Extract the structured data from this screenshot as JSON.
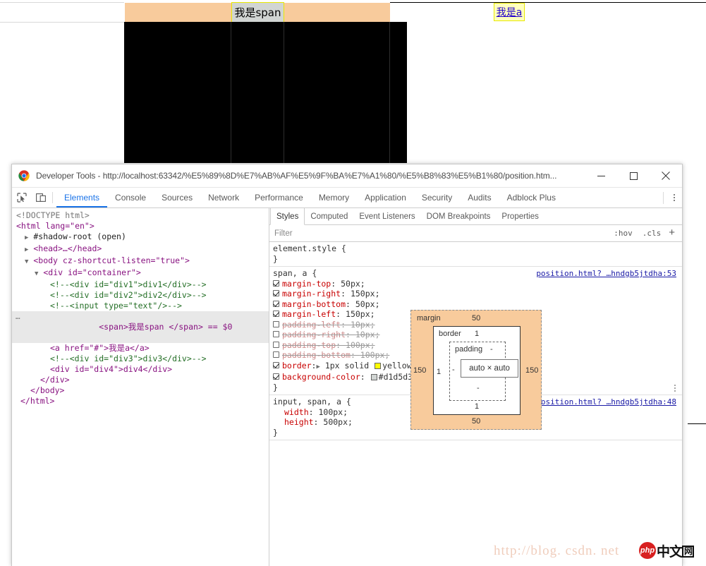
{
  "webpage": {
    "span_text": "我是span",
    "link_text": "我是a"
  },
  "devtools": {
    "window_title": "Developer Tools - http://localhost:63342/%E5%89%8D%E7%AB%AF%E5%9F%BA%E7%A1%80/%E5%B8%83%E5%B1%80/position.htm...",
    "minimize_label": "Minimize",
    "maximize_label": "Maximize",
    "close_label": "Close",
    "icons": {
      "inspect": "inspect-element-icon",
      "device": "device-toolbar-icon",
      "kebab": "more-options-icon"
    },
    "tabs": [
      {
        "label": "Elements",
        "active": true
      },
      {
        "label": "Console",
        "active": false
      },
      {
        "label": "Sources",
        "active": false
      },
      {
        "label": "Network",
        "active": false
      },
      {
        "label": "Performance",
        "active": false
      },
      {
        "label": "Memory",
        "active": false
      },
      {
        "label": "Application",
        "active": false
      },
      {
        "label": "Security",
        "active": false
      },
      {
        "label": "Audits",
        "active": false
      },
      {
        "label": "Adblock Plus",
        "active": false
      }
    ],
    "dom_tree": [
      {
        "id": "doctype",
        "indent": 0,
        "text": "<!DOCTYPE html>"
      },
      {
        "id": "html",
        "indent": 0,
        "text": "<html lang=\"en\">"
      },
      {
        "id": "shadow",
        "indent": 1,
        "text": "#shadow-root (open)"
      },
      {
        "id": "head",
        "indent": 1,
        "text": "<head>…</head>"
      },
      {
        "id": "body",
        "indent": 1,
        "text": "<body cz-shortcut-listen=\"true\">"
      },
      {
        "id": "container",
        "indent": 2,
        "text": "<div id=\"container\">"
      },
      {
        "id": "c1",
        "indent": 3,
        "text": "<!--<div id=\"div1\">div1</div>-->"
      },
      {
        "id": "c2",
        "indent": 3,
        "text": "<!--<div id=\"div2\">div2</div>-->"
      },
      {
        "id": "c3",
        "indent": 3,
        "text": "<!--<input type=\"text\"/>-->"
      },
      {
        "id": "span",
        "indent": 3,
        "text": "<span>我是span </span> == $0"
      },
      {
        "id": "a",
        "indent": 3,
        "text": "<a href=\"#\">我是a</a>"
      },
      {
        "id": "c4",
        "indent": 3,
        "text": "<!--<div id=\"div3\">div3</div>-->"
      },
      {
        "id": "div4",
        "indent": 3,
        "text": "<div id=\"div4\">div4</div>"
      },
      {
        "id": "divclose",
        "indent": 2,
        "text": "</div>"
      },
      {
        "id": "bodyclose",
        "indent": 1,
        "text": "</body>"
      },
      {
        "id": "htmlclose",
        "indent": 0,
        "text": "</html>"
      }
    ],
    "style_tabs": [
      {
        "label": "Styles",
        "active": true
      },
      {
        "label": "Computed",
        "active": false
      },
      {
        "label": "Event Listeners",
        "active": false
      },
      {
        "label": "DOM Breakpoints",
        "active": false
      },
      {
        "label": "Properties",
        "active": false
      }
    ],
    "filter": {
      "placeholder": "Filter",
      "hov_label": ":hov",
      "cls_label": ".cls",
      "add_label": "+"
    },
    "css_rules": [
      {
        "selector": "element.style {",
        "close": "}",
        "source": "",
        "declarations": []
      },
      {
        "selector": "span, a {",
        "close": "}",
        "source": "position.html? …hndgb5jtdha:53",
        "declarations": [
          {
            "name": "margin-top",
            "value": "50px;",
            "enabled": true,
            "swatch": null
          },
          {
            "name": "margin-right",
            "value": "150px;",
            "enabled": true,
            "swatch": null
          },
          {
            "name": "margin-bottom",
            "value": "50px;",
            "enabled": true,
            "swatch": null
          },
          {
            "name": "margin-left",
            "value": "150px;",
            "enabled": true,
            "swatch": null
          },
          {
            "name": "padding-left",
            "value": "10px;",
            "enabled": false,
            "swatch": null
          },
          {
            "name": "padding-right",
            "value": "10px;",
            "enabled": false,
            "swatch": null
          },
          {
            "name": "padding-top",
            "value": "100px;",
            "enabled": false,
            "swatch": null
          },
          {
            "name": "padding-bottom",
            "value": "100px;",
            "enabled": false,
            "swatch": null
          },
          {
            "name": "border",
            "value": "▶ 1px solid yellow;",
            "enabled": true,
            "swatch": "#ffff00"
          },
          {
            "name": "background-color",
            "value": "#d1d5d3;",
            "enabled": true,
            "swatch": "#d1d5d3"
          }
        ]
      },
      {
        "selector": "input, span, a {",
        "close": "}",
        "source": "position.html? …hndgb5jtdha:48",
        "declarations": [
          {
            "name": "width",
            "value": "100px;",
            "enabled": true,
            "swatch": null,
            "plain": true
          },
          {
            "name": "height",
            "value": "500px;",
            "enabled": true,
            "swatch": null,
            "plain": true
          }
        ]
      }
    ],
    "box_model": {
      "margin_label": "margin",
      "border_label": "border",
      "padding_label": "padding",
      "content": "auto × auto",
      "margin_top": "50",
      "margin_bottom": "50",
      "margin_left": "150",
      "margin_right": "150",
      "border_top": "1",
      "border_bottom": "1",
      "border_left": "1",
      "border_right": "1",
      "padding_top": "-",
      "padding_bottom": "-",
      "padding_left": "-",
      "padding_right": "-"
    }
  },
  "watermark": {
    "url": "http://blog. csdn. net",
    "badge_text": "php",
    "badge_cn": "中文",
    "badge_cn2": "网"
  }
}
